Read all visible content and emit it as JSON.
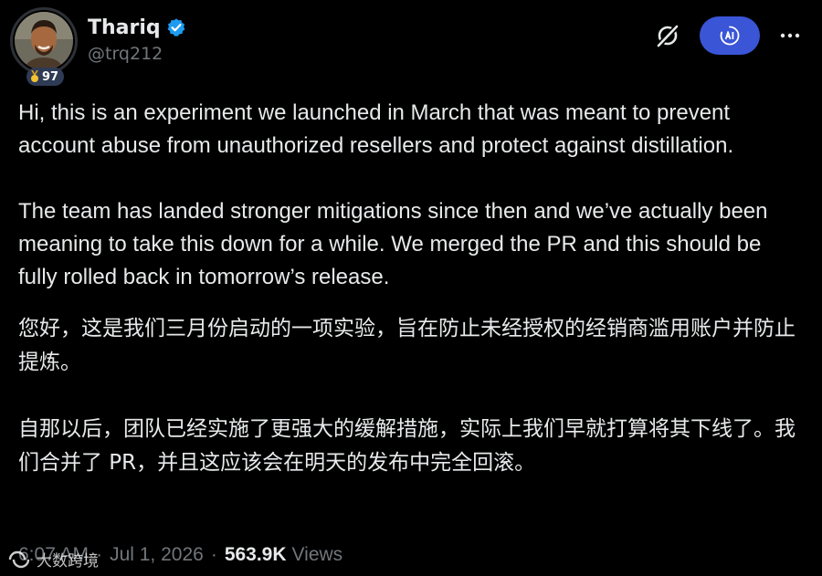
{
  "author": {
    "display_name": "Thariq",
    "handle": "@trq212",
    "level": "97"
  },
  "icons": {
    "verified": "verified-badge-icon",
    "grok": "grok-icon",
    "ai": "ai-icon",
    "more": "more-icon",
    "medal": "medal-icon"
  },
  "colors": {
    "verified": "#1d9bf0",
    "ai_button": "#3a55d6",
    "text": "#e7e9ea",
    "muted": "#71767b"
  },
  "post": {
    "paragraphs_en": [
      "Hi, this is an experiment we launched in March that was meant to prevent account abuse from unauthorized resellers and protect against distillation.",
      "The team has landed stronger mitigations since then and we’ve actually been meaning to take this down for a while. We merged the PR and this should be fully rolled back in tomorrow’s release."
    ],
    "paragraphs_zh": [
      "您好，这是我们三月份启动的一项实验，旨在防止未经授权的经销商滥用账户并防止提炼。",
      "自那以后，团队已经实施了更强大的缓解措施，实际上我们早就打算将其下线了。我们合并了 PR，并且这应该会在明天的发布中完全回滚。"
    ]
  },
  "meta": {
    "time": "6:07 AM",
    "separator": "·",
    "date": "Jul 1, 2026",
    "views_count": "563.9K",
    "views_label": "Views"
  },
  "watermark": {
    "text": "大数跨境"
  }
}
